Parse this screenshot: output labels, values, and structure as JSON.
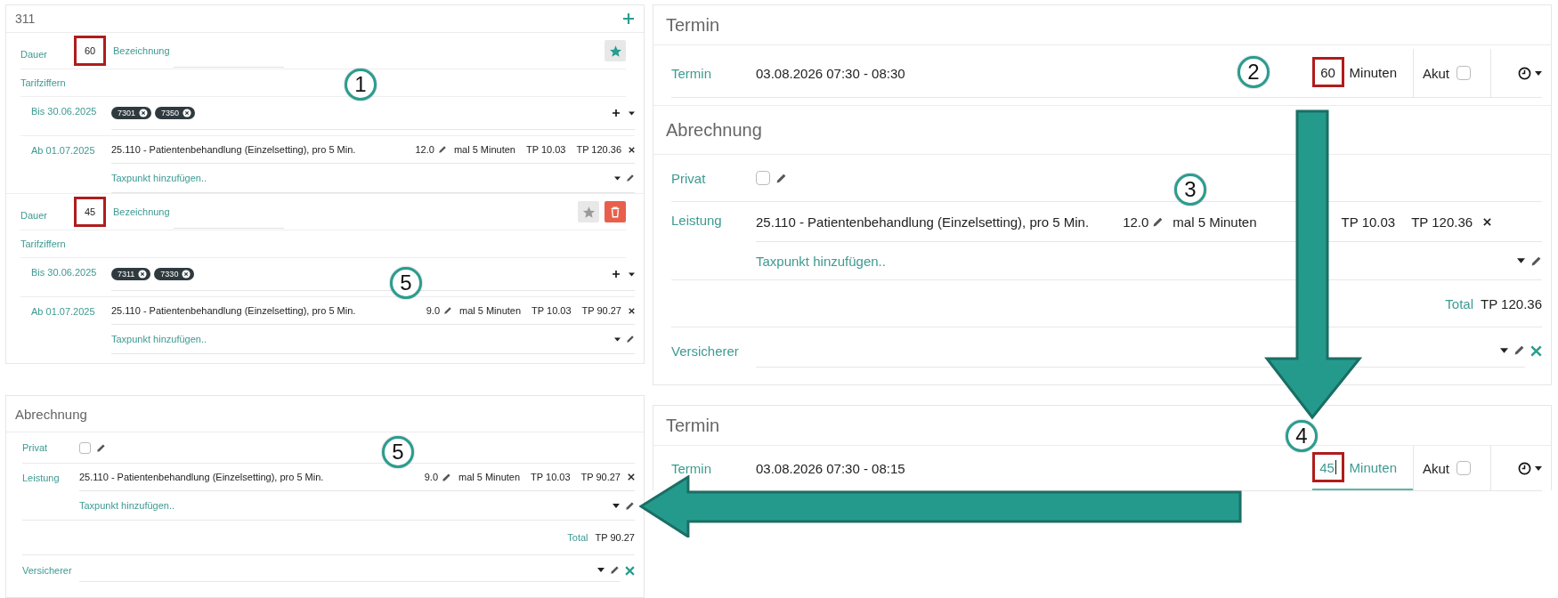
{
  "template_card": {
    "title": "311",
    "variants": [
      {
        "duration_label": "Dauer",
        "duration": "60",
        "highlighted": true,
        "name_label": "Bezeichnung",
        "favorite": true,
        "deletable": false,
        "tariff_label": "Tarifziffern",
        "old_period": {
          "label": "Bis 30.06.2025",
          "tags": [
            "7301",
            "7350"
          ]
        },
        "new_period": {
          "label": "Ab 01.07.2025",
          "service": {
            "description": "25.110 - Patientenbehandlung (Einzelsetting), pro 5 Min.",
            "quantity": "12.0",
            "unit": "mal 5 Minuten",
            "rate": "TP 10.03",
            "amount": "TP 120.36"
          },
          "add_placeholder": "Taxpunkt hinzufügen.."
        }
      },
      {
        "duration_label": "Dauer",
        "duration": "45",
        "highlighted": true,
        "name_label": "Bezeichnung",
        "favorite": false,
        "deletable": true,
        "tariff_label": "Tarifziffern",
        "old_period": {
          "label": "Bis 30.06.2025",
          "tags": [
            "7311",
            "7330"
          ]
        },
        "new_period": {
          "label": "Ab 01.07.2025",
          "service": {
            "description": "25.110 - Patientenbehandlung (Einzelsetting), pro 5 Min.",
            "quantity": "9.0",
            "unit": "mal 5 Minuten",
            "rate": "TP 10.03",
            "amount": "TP 90.27"
          },
          "add_placeholder": "Taxpunkt hinzufügen.."
        }
      }
    ]
  },
  "billing": {
    "title": "Abrechnung",
    "private_label": "Privat",
    "private": false,
    "service_label": "Leistung",
    "service": {
      "description": "25.110 - Patientenbehandlung (Einzelsetting), pro 5 Min.",
      "quantity": "9.0",
      "unit": "mal 5 Minuten",
      "rate": "TP 10.03",
      "amount": "TP 90.27"
    },
    "add_placeholder": "Taxpunkt hinzufügen..",
    "total_label": "Total",
    "total": "TP 90.27",
    "insurer_label": "Versicherer"
  },
  "appointments": [
    {
      "termin": {
        "title": "Termin",
        "label": "Termin",
        "datetime": "03.08.2026 07:30 - 08:30",
        "duration": "60",
        "highlighted": true,
        "focused": false,
        "unit": "Minuten",
        "acute_label": "Akut",
        "acute": false
      },
      "billing": {
        "title": "Abrechnung",
        "private_label": "Privat",
        "private": false,
        "service_label": "Leistung",
        "service": {
          "description": "25.110 - Patientenbehandlung (Einzelsetting), pro 5 Min.",
          "quantity": "12.0",
          "unit": "mal 5 Minuten",
          "rate": "TP 10.03",
          "amount": "TP 120.36"
        },
        "add_placeholder": "Taxpunkt hinzufügen..",
        "total_label": "Total",
        "total": "TP 120.36",
        "insurer_label": "Versicherer"
      }
    },
    {
      "termin": {
        "title": "Termin",
        "label": "Termin",
        "datetime": "03.08.2026 07:30 - 08:15",
        "duration": "45",
        "highlighted": true,
        "focused": true,
        "unit": "Minuten",
        "acute_label": "Akut",
        "acute": false
      }
    }
  ],
  "callouts": [
    {
      "label": "1"
    },
    {
      "label": "5"
    },
    {
      "label": "2"
    },
    {
      "label": "3"
    },
    {
      "label": "5"
    },
    {
      "label": "4"
    }
  ]
}
